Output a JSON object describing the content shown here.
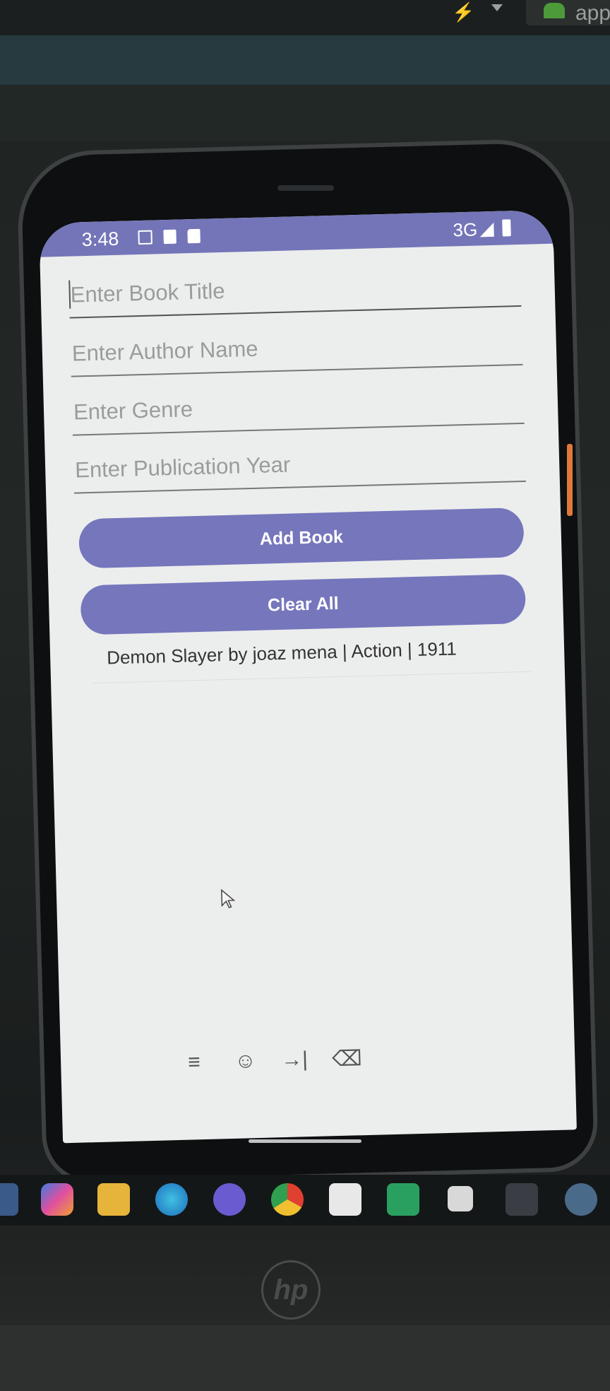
{
  "desktop": {
    "app_label": "app",
    "taskbar_icons": [
      "windows-icon",
      "copilot-icon",
      "file-explorer-icon",
      "edge-icon",
      "viber-icon",
      "chrome-icon",
      "acrobat-icon",
      "android-studio-icon",
      "capcut-icon",
      "notepad-icon",
      "other-icon"
    ]
  },
  "statusbar": {
    "time": "3:48",
    "network": "3G"
  },
  "form": {
    "title_placeholder": "Enter Book Title",
    "author_placeholder": "Enter Author Name",
    "genre_placeholder": "Enter Genre",
    "year_placeholder": "Enter Publication Year",
    "add_label": "Add Book",
    "clear_label": "Clear All"
  },
  "books": [
    {
      "text": "Demon Slayer by joaz mena | Action | 1911"
    }
  ],
  "keyboard_toolbar": {
    "menu": "≡",
    "emoji": "☺",
    "tab": "→|",
    "delete": "⌫"
  },
  "laptop": {
    "brand": "hp"
  },
  "colors": {
    "accent": "#7676bd",
    "statusbar": "#7475b8"
  }
}
